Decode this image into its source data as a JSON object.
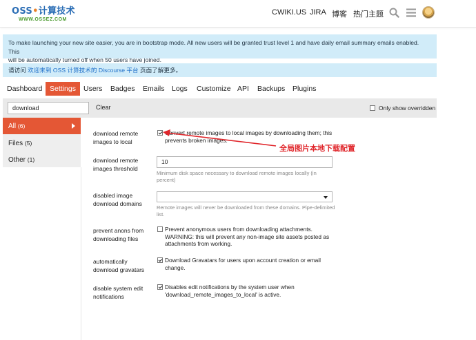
{
  "header": {
    "logo_title_a": "OSS",
    "logo_dot": "•",
    "logo_title_b": "计算技术",
    "logo_sub": "WWW.OSSEZ.COM",
    "nav": [
      {
        "label": "CWIKI.US"
      },
      {
        "label": "JIRA"
      },
      {
        "label": "博客"
      },
      {
        "label": "热门主题"
      }
    ],
    "icons": [
      "search-icon",
      "hamburger-menu-icon",
      "avatar"
    ]
  },
  "alerts": {
    "bootstrap_line1": "To make launching your new site easier, you are in bootstrap mode. All new users will be granted trust level 1 and have daily email summary emails enabled. This",
    "bootstrap_line2": "will be automatically turned off when 50 users have joined.",
    "visit_prefix": "请访问 ",
    "visit_link": "欢迎来到 OSS 计算技术的 Discourse 平台",
    "visit_suffix": " 页面了解更多。"
  },
  "tabs": [
    {
      "label": "Dashboard",
      "active": false
    },
    {
      "label": "Settings",
      "active": true
    },
    {
      "label": "Users",
      "active": false
    },
    {
      "label": "Badges",
      "active": false
    },
    {
      "label": "Emails",
      "active": false
    },
    {
      "label": "Logs",
      "active": false
    },
    {
      "label": "Customize",
      "active": false
    },
    {
      "label": "API",
      "active": false
    },
    {
      "label": "Backups",
      "active": false
    },
    {
      "label": "Plugins",
      "active": false
    }
  ],
  "filter": {
    "search_value": "download",
    "clear_label": "Clear",
    "only_overridden_label": "Only show overridden",
    "only_overridden_checked": false
  },
  "categories": [
    {
      "label": "All",
      "count": "(6)",
      "active": true
    },
    {
      "label": "Files",
      "count": "(5)",
      "active": false
    },
    {
      "label": "Other",
      "count": "(1)",
      "active": false
    }
  ],
  "settings": {
    "download_remote_images": {
      "label_1": "download remote",
      "label_2": "images to local",
      "checked": true,
      "desc_1": "Convert remote images to local images by downloading them; this",
      "desc_2": "prevents broken images."
    },
    "threshold": {
      "label_1": "download remote",
      "label_2": "images threshold",
      "value": "10",
      "hint_1": "Minimum disk space necessary to download remote images locally (in",
      "hint_2": "percent)"
    },
    "disabled_domains": {
      "label_1": "disabled image",
      "label_2": "download domains",
      "value": "",
      "hint_1": "Remote images will never be downloaded from these domains. Pipe-delimited",
      "hint_2": "list."
    },
    "prevent_anons": {
      "label_1": "prevent anons from",
      "label_2": "downloading files",
      "checked": false,
      "desc_1": "Prevent anonymous users from downloading attachments.",
      "desc_2": "WARNING: this will prevent any non-image site assets posted as",
      "desc_3": "attachments from working."
    },
    "gravatars": {
      "label_1": "automatically",
      "label_2": "download gravatars",
      "checked": true,
      "desc_1": "Download Gravatars for users upon account creation or email",
      "desc_2": "change."
    },
    "disable_edit_notifications": {
      "label_1": "disable system edit",
      "label_2": "notifications",
      "checked": true,
      "desc_1": "Disables edit notifications by the system user when",
      "desc_2": "'download_remote_images_to_local' is active."
    }
  },
  "annotation": {
    "text": "全局图片本地下载配置",
    "color": "#e0262b"
  },
  "colors": {
    "accent": "#e45735",
    "alert_bg": "#d1ecf9",
    "link": "#1e6fc9"
  }
}
